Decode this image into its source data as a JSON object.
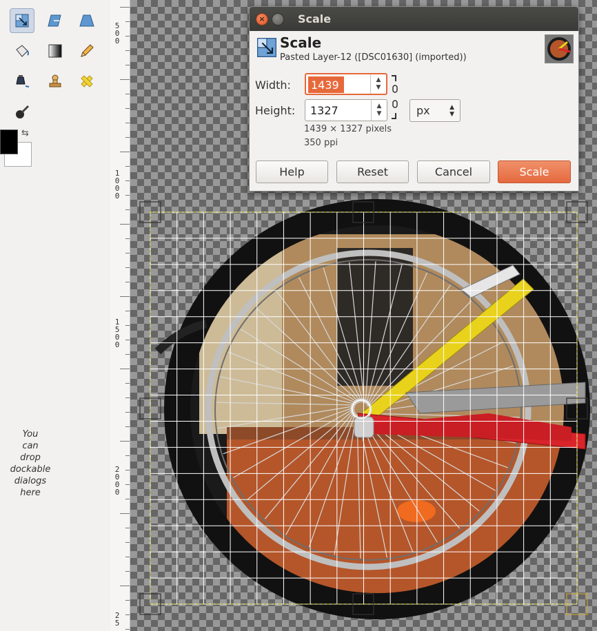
{
  "toolbox": {
    "tools": [
      {
        "name": "scale-tool-icon",
        "active": true
      },
      {
        "name": "shear-tool-icon",
        "active": false
      },
      {
        "name": "perspective-tool-icon",
        "active": false
      },
      {
        "name": "bucket-fill-tool-icon",
        "active": false
      },
      {
        "name": "blend-tool-icon",
        "active": false
      },
      {
        "name": "pencil-tool-icon",
        "active": false
      },
      {
        "name": "ink-tool-icon",
        "active": false
      },
      {
        "name": "clone-tool-icon",
        "active": false
      },
      {
        "name": "heal-tool-icon",
        "active": false
      },
      {
        "name": "smudge-tool-icon",
        "active": false
      }
    ],
    "foreground_color": "#000000",
    "background_color": "#ffffff",
    "dock_hint_lines": [
      "You",
      "can",
      "drop",
      "dockable",
      "dialogs",
      "here"
    ]
  },
  "ruler": {
    "labels": [
      {
        "digits": [
          "5",
          "0",
          "0"
        ]
      },
      {
        "digits": [
          "1",
          "0",
          "0",
          "0"
        ]
      },
      {
        "digits": [
          "1",
          "5",
          "0",
          "0"
        ]
      },
      {
        "digits": [
          "2",
          "0",
          "0",
          "0"
        ]
      },
      {
        "digits": [
          "2",
          "5"
        ]
      }
    ]
  },
  "dialog": {
    "window_title": "Scale",
    "title": "Scale",
    "subtitle": "Pasted Layer-12 ([DSC01630] (imported))",
    "width_label": "Width:",
    "width_value": "1439",
    "height_label": "Height:",
    "height_value": "1327",
    "unit": "px",
    "size_info": "1439 × 1327 pixels",
    "resolution_info": "350 ppi",
    "buttons": {
      "help": "Help",
      "reset": "Reset",
      "cancel": "Cancel",
      "scale": "Scale"
    },
    "accent_color": "#e7683a"
  }
}
